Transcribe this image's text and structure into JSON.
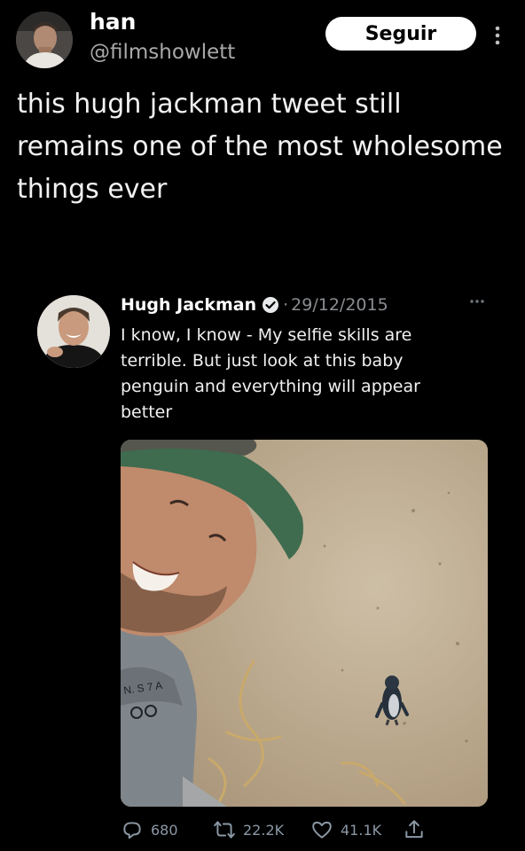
{
  "post": {
    "author_name": "han",
    "author_handle": "@filmshowlett",
    "follow_label": "Seguir",
    "text": "this hugh jackman tweet still remains one of the most wholesome things ever"
  },
  "quoted": {
    "name": "Hugh Jackman",
    "date": "29/12/2015",
    "separator": "·",
    "text": "I know, I know - My selfie skills are terrible. But just look at this baby penguin and everything will appear better",
    "photo_print": "N. S 7 A"
  },
  "actions": {
    "replies": "680",
    "retweets": "22.2K",
    "likes": "41.1K"
  },
  "colors": {
    "background": "#000000",
    "text": "#e7e9ea",
    "muted": "#8b98a5",
    "follow_bg": "#ffffff"
  },
  "icons": [
    "more-vertical-icon",
    "verified-badge-icon",
    "more-horizontal-icon",
    "reply-icon",
    "retweet-icon",
    "like-icon",
    "share-icon"
  ]
}
